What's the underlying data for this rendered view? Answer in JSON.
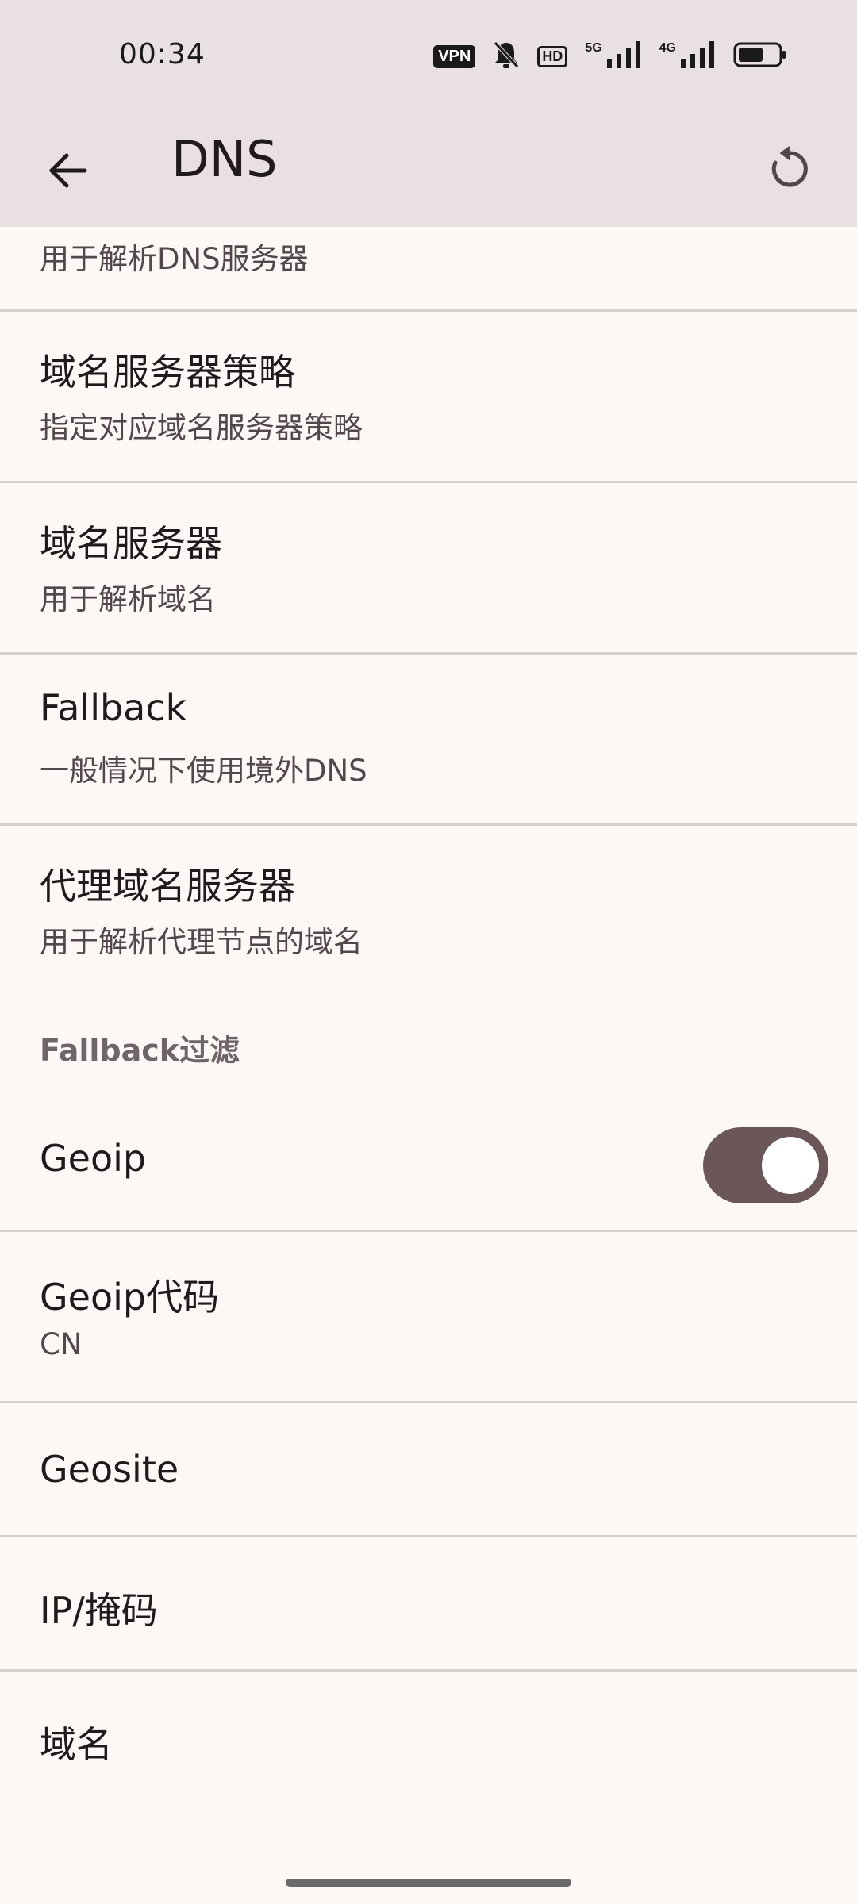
{
  "status_bar": {
    "time": "00:34",
    "vpn": "VPN",
    "hd": "HD",
    "net_5g": "5G",
    "net_4g": "4G"
  },
  "app_bar": {
    "title": "DNS"
  },
  "items": [
    {
      "title": "",
      "subtitle": "用于解析DNS服务器"
    },
    {
      "title": "域名服务器策略",
      "subtitle": "指定对应域名服务器策略"
    },
    {
      "title": "域名服务器",
      "subtitle": "用于解析域名"
    },
    {
      "title": "Fallback",
      "subtitle": "一般情况下使用境外DNS"
    },
    {
      "title": "代理域名服务器",
      "subtitle": "用于解析代理节点的域名"
    }
  ],
  "section": {
    "header": "Fallback过滤"
  },
  "filter_items": {
    "geoip": {
      "title": "Geoip",
      "enabled": true
    },
    "geoip_code": {
      "title": "Geoip代码",
      "subtitle": "CN"
    },
    "geosite": {
      "title": "Geosite"
    },
    "ip_mask": {
      "title": "IP/掩码"
    },
    "domain": {
      "title": "域名"
    }
  },
  "colors": {
    "background": "#fdf8f6",
    "app_bar": "#e9e1e1",
    "toggle_track": "#6b575a",
    "divider": "#d6cfcf"
  }
}
